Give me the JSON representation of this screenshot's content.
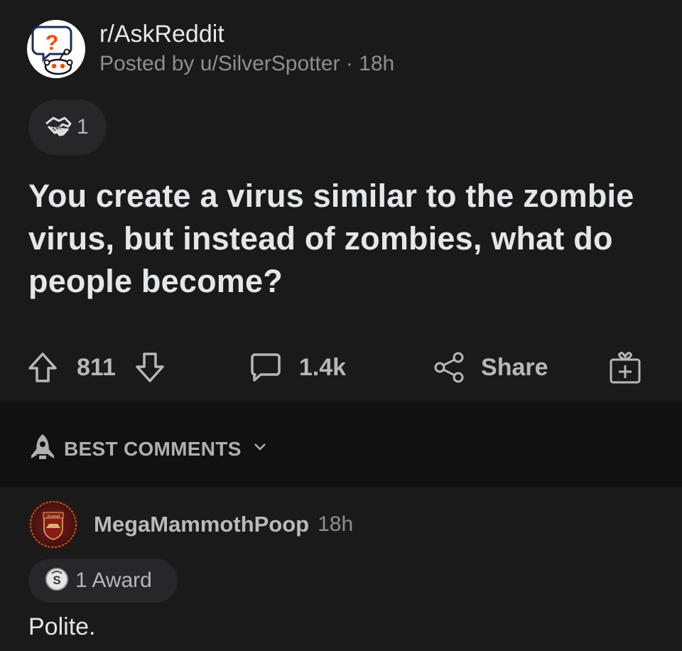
{
  "post": {
    "subreddit": "r/AskReddit",
    "meta": "Posted by u/SilverSpotter · 18h",
    "award_count": "1",
    "title": "You create a virus similar to the zombie virus, but instead of zombies, what do people become?",
    "votes": "811",
    "comments": "1.4k",
    "share_label": "Share"
  },
  "sort": {
    "label": "BEST COMMENTS"
  },
  "comment": {
    "username": "MegaMammothPoop",
    "time": "18h",
    "avatar_text": "Arsenal",
    "award_label": "1 Award",
    "body": "Polite."
  },
  "icons": {
    "subreddit": "askreddit-snoo-icon",
    "post_award": "handshake-award-icon",
    "upvote": "upvote-arrow-icon",
    "downvote": "downvote-arrow-icon",
    "comment": "comment-bubble-icon",
    "share": "share-icon",
    "gift": "gift-award-icon",
    "sort": "rocket-icon",
    "comment_award": "silver-award-icon"
  },
  "colors": {
    "background": "#1a1a1b",
    "sort_bar": "#111112",
    "pill": "#272729",
    "question_mark": "#ff4500"
  }
}
